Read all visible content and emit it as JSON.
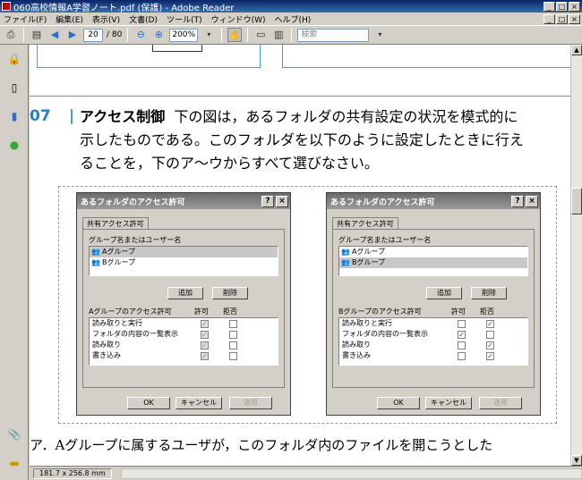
{
  "window": {
    "title": "060高校情報A学習ノート.pdf (保護) - Adobe Reader",
    "min": "_",
    "max": "□",
    "close": "×"
  },
  "menu": [
    "ファイル(F)",
    "編集(E)",
    "表示(V)",
    "文書(D)",
    "ツール(T)",
    "ウィンドウ(W)",
    "ヘルプ(H)"
  ],
  "toolbar": {
    "page_current": "20",
    "page_total": "/ 80",
    "zoom": "200%",
    "search_placeholder": "検索"
  },
  "status": {
    "dimensions": "181.7 x 256.8 mm"
  },
  "question": {
    "number": "07",
    "title": "アクセス制御",
    "line1": "下の図は，あるフォルダの共有設定の状況を模式的に",
    "line2": "示したものである。このフォルダを以下のように設定したときに行え",
    "line3": "ることを，下のア～ウからすべて選びなさい。"
  },
  "dialog_left": {
    "title": "あるフォルダのアクセス許可",
    "help": "?",
    "close": "×",
    "tab": "共有アクセス許可",
    "group_label": "グループ名またはユーザー名",
    "groups": [
      "Aグループ",
      "Bグループ"
    ],
    "selected_group": 0,
    "add_button": "追加",
    "remove_button": "削除",
    "perm_label": "Aグループのアクセス許可",
    "allow_label": "許可",
    "deny_label": "拒否",
    "permissions": [
      {
        "name": "読み取りと実行",
        "allow": "✓",
        "deny": ""
      },
      {
        "name": "フォルダの内容の一覧表示",
        "allow": "✓",
        "deny": ""
      },
      {
        "name": "読み取り",
        "allow": "✓",
        "deny": ""
      },
      {
        "name": "書き込み",
        "allow": "✓",
        "deny": ""
      }
    ],
    "ok": "OK",
    "cancel": "キャンセル",
    "apply": "適用"
  },
  "dialog_right": {
    "title": "あるフォルダのアクセス許可",
    "help": "?",
    "close": "×",
    "tab": "共有アクセス許可",
    "group_label": "グループ名またはユーザー名",
    "groups": [
      "Aグループ",
      "Bグループ"
    ],
    "selected_group": 1,
    "add_button": "追加",
    "remove_button": "削除",
    "perm_label": "Bグループのアクセス許可",
    "allow_label": "許可",
    "deny_label": "拒否",
    "permissions": [
      {
        "name": "読み取りと実行",
        "allow": "",
        "deny": "✓"
      },
      {
        "name": "フォルダの内容の一覧表示",
        "allow": "✓",
        "deny": ""
      },
      {
        "name": "読み取り",
        "allow": "",
        "deny": "✓"
      },
      {
        "name": "書き込み",
        "allow": "",
        "deny": "✓"
      }
    ],
    "ok": "OK",
    "cancel": "キャンセル",
    "apply": "適用"
  },
  "answer_a": "ア．Aグループに属するユーザが，このフォルダ内のファイルを開こうとした"
}
